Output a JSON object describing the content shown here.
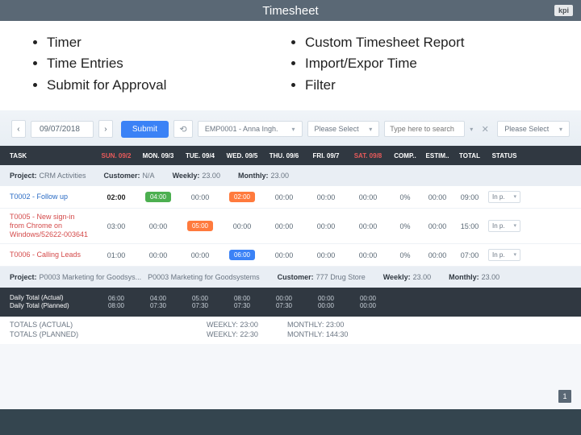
{
  "header": {
    "title": "Timesheet",
    "logo": "kpi"
  },
  "features": {
    "left": [
      "Timer",
      "Time Entries",
      "Submit for Approval"
    ],
    "right": [
      "Custom Timesheet Report",
      "Import/Expor Time",
      "Filter"
    ]
  },
  "toolbar": {
    "date": "09/07/2018",
    "submit": "Submit",
    "employee": "EMP0001 - Anna Ingh.",
    "select1": "Please Select",
    "search_ph": "Type here to search",
    "select2": "Please Select"
  },
  "days": {
    "task": "TASK",
    "cols": [
      "SUN. 09/2",
      "MON. 09/3",
      "TUE. 09/4",
      "WED. 09/5",
      "THU. 09/6",
      "FRI. 09/7",
      "SAT. 09/8"
    ],
    "stats": [
      "COMP..",
      "ESTIM..",
      "TOTAL",
      "STATUS"
    ]
  },
  "proj1": {
    "project": "CRM Activities",
    "customer": "N/A",
    "weekly": "23.00",
    "monthly": "23.00"
  },
  "rows": [
    {
      "name": "T0002 - Follow up",
      "cells": [
        "02:00",
        "04:00",
        "00:00",
        "02:00",
        "00:00",
        "00:00",
        "00:00"
      ],
      "pills": {
        "1": "green",
        "3": "orange"
      },
      "comp": "0%",
      "est": "00:00",
      "total": "09:00",
      "status": "In p.",
      "bold0": true
    },
    {
      "name": "T0005 - New sign-in from Chrome on Windows/52622-003641",
      "cells": [
        "03:00",
        "00:00",
        "05:00",
        "00:00",
        "00:00",
        "00:00",
        "00:00"
      ],
      "pills": {
        "2": "orange"
      },
      "comp": "0%",
      "est": "00:00",
      "total": "15:00",
      "status": "In p.",
      "red": true
    },
    {
      "name": "T0006 - Calling Leads",
      "cells": [
        "01:00",
        "00:00",
        "00:00",
        "06:00",
        "00:00",
        "00:00",
        "00:00"
      ],
      "pills": {
        "3": "blue"
      },
      "comp": "0%",
      "est": "00:00",
      "total": "07:00",
      "status": "In p.",
      "red": true
    }
  ],
  "proj2": {
    "project": "P0003 Marketing for Goodsys...",
    "project2": "P0003 Marketing for Goodsystems",
    "customer": "777 Drug Store",
    "weekly": "23.00",
    "monthly": "23.00"
  },
  "daily": {
    "label1": "Daily Total (Actual)",
    "label2": "Daily Total (Planned)",
    "actual": [
      "06:00",
      "04:00",
      "05:00",
      "08:00",
      "00:00",
      "00:00",
      "00:00"
    ],
    "planned": [
      "08:00",
      "07:30",
      "07:30",
      "07:30",
      "07:30",
      "00:00",
      "00:00"
    ]
  },
  "footer": {
    "l1": "TOTALS (ACTUAL)",
    "l2": "TOTALS (PLANNED)",
    "w1": "WEEKLY: 23:00",
    "m1": "MONTHLY: 23:00",
    "w2": "WEEKLY: 22:30",
    "m2": "MONTHLY: 144:30"
  },
  "page": "1"
}
